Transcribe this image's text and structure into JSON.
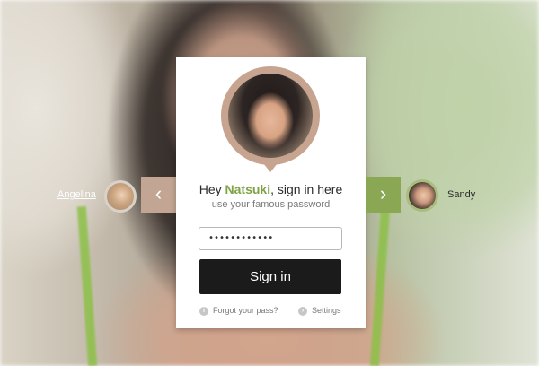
{
  "card": {
    "greeting_prefix": "Hey ",
    "greeting_name": "Natsuki",
    "greeting_suffix": ", sign in here",
    "subtitle": "use your famous password",
    "password_value": "••••••••••••",
    "signin_label": "Sign in",
    "forgot_label": "Forgot your pass?",
    "settings_label": "Settings"
  },
  "nav": {
    "prev_user": "Angelina",
    "next_user": "Sandy",
    "prev_icon": "chevron-left-icon",
    "next_icon": "chevron-right-icon"
  },
  "colors": {
    "accent_green": "#8aa754",
    "accent_tan": "#c2a693",
    "button_dark": "#1b1b1b"
  }
}
